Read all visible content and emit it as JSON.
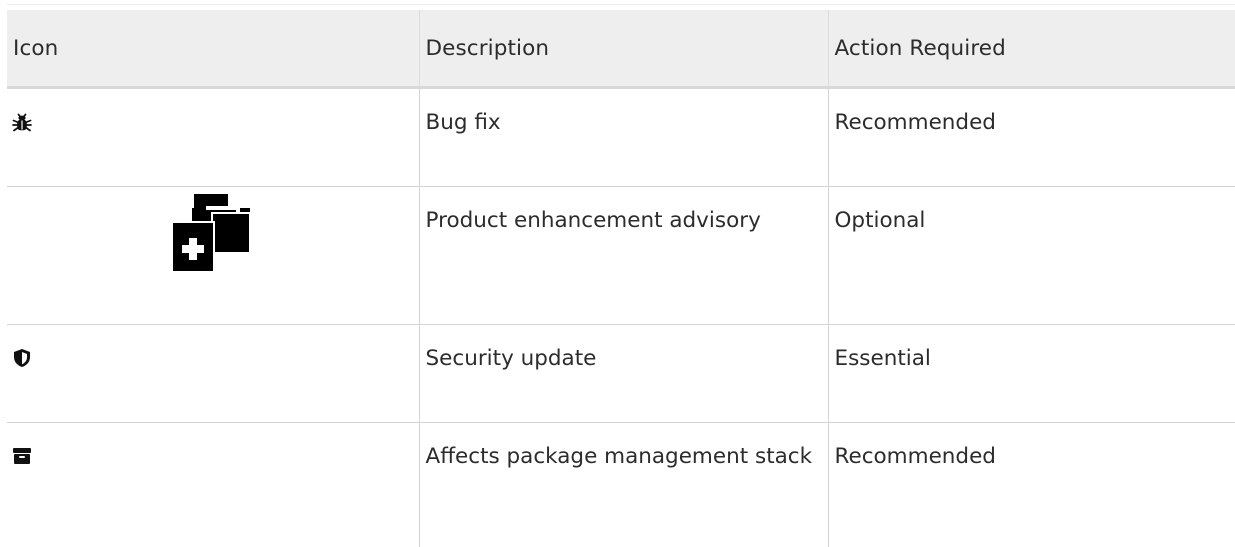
{
  "table": {
    "headers": [
      "Icon",
      "Description",
      "Action Required"
    ],
    "rows": [
      {
        "icon": "bug-icon",
        "description": "Bug fix",
        "action": "Recommended"
      },
      {
        "icon": "enhancement-icon",
        "description": "Product enhancement advisory",
        "action": "Optional"
      },
      {
        "icon": "shield-icon",
        "description": "Security update",
        "action": "Essential"
      },
      {
        "icon": "package-archive-icon",
        "description": "Affects package management stack",
        "action": "Recommended"
      }
    ]
  }
}
